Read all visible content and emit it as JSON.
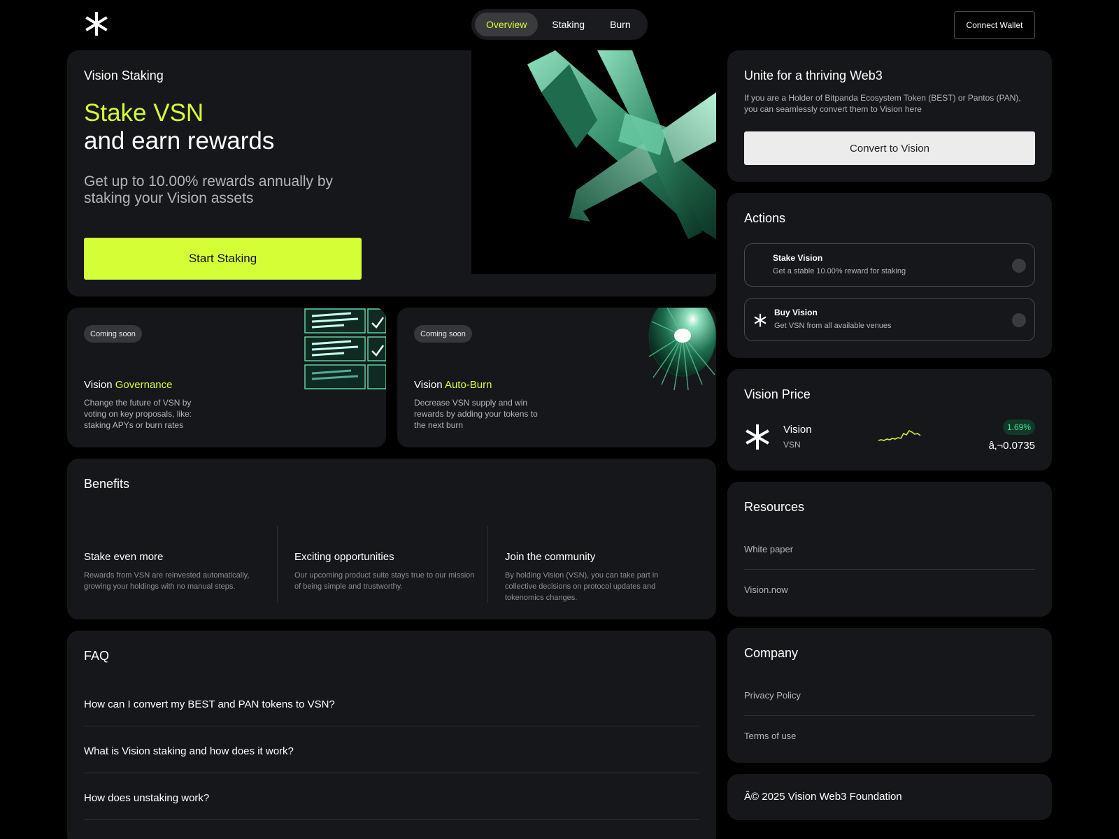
{
  "nav": {
    "tabs": [
      {
        "label": "Overview"
      },
      {
        "label": "Staking"
      },
      {
        "label": "Burn"
      }
    ],
    "connect_label": "Connect Wallet"
  },
  "hero": {
    "label": "Vision Staking",
    "title_highlight": "Stake VSN",
    "title_rest": "and earn rewards",
    "subtitle": "Get up to 10.00% rewards annually by staking your Vision assets",
    "button": "Start Staking"
  },
  "governance": {
    "badge": "Coming soon",
    "title_prefix": "Vision",
    "title_highlight": "Governance",
    "desc": "Change the future of VSN by voting on key proposals, like: staking APYs or burn rates"
  },
  "autoburn": {
    "badge": "Coming soon",
    "title_prefix": "Vision",
    "title_highlight": "Auto-Burn",
    "desc": "Decrease VSN supply and win rewards by adding your tokens to the next burn"
  },
  "benefits": {
    "title": "Benefits",
    "items": [
      {
        "title": "Stake even more",
        "desc": "Rewards from VSN are reinvested automatically, growing your holdings with no manual steps."
      },
      {
        "title": "Exciting opportunities",
        "desc": "Our upcoming product suite stays true to our mission of being simple and trustworthy."
      },
      {
        "title": "Join the community",
        "desc": "By holding Vision (VSN), you can take part in collective decisions on protocol updates and tokenomics changes."
      }
    ]
  },
  "faq": {
    "title": "FAQ",
    "items": [
      {
        "q": "How can I convert my BEST and PAN tokens to VSN?"
      },
      {
        "q": "What is Vision staking and how does it work?"
      },
      {
        "q": "How does unstaking work?"
      }
    ]
  },
  "unite": {
    "title": "Unite for a thriving Web3",
    "desc": "If you are a Holder of Bitpanda Ecosystem Token (BEST) or Pantos (PAN), you can seamlessly convert them to Vision here",
    "button": "Convert to Vision"
  },
  "actions": {
    "title": "Actions",
    "items": [
      {
        "title": "Stake Vision",
        "desc": "Get a stable 10.00% reward for staking"
      },
      {
        "title": "Buy Vision",
        "desc": "Get VSN from all available venues"
      }
    ]
  },
  "price": {
    "title": "Vision Price",
    "name": "Vision",
    "symbol": "VSN",
    "change": "1.69%",
    "value": "â‚¬0.0735",
    "spark_color": "#c9f23a"
  },
  "resources": {
    "title": "Resources",
    "links": [
      {
        "label": "White paper"
      },
      {
        "label": "Vision.now"
      }
    ]
  },
  "company": {
    "title": "Company",
    "links": [
      {
        "label": "Privacy Policy"
      },
      {
        "label": "Terms of use"
      }
    ]
  },
  "footer": {
    "text": "Â© 2025 Vision Web3 Foundation"
  },
  "colors": {
    "accent": "#d4ff37",
    "card": "#16171a",
    "background": "#000000"
  }
}
